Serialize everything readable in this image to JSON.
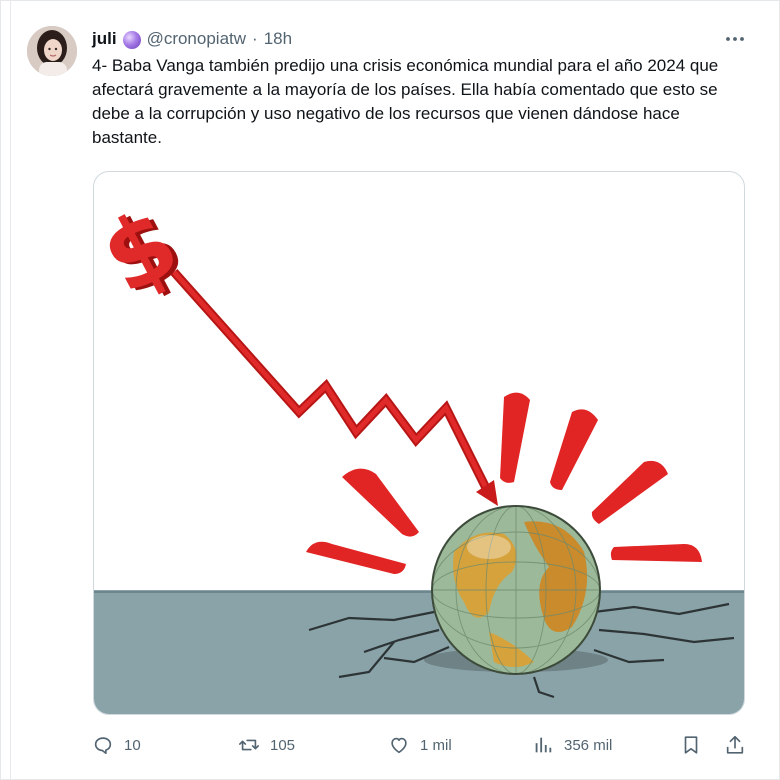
{
  "tweet": {
    "author": {
      "name": "juli",
      "emoji_icon": "crystal-ball-icon",
      "handle": "@cronopiatw",
      "separator": "·",
      "time": "18h"
    },
    "more_icon": "more-horizontal-icon",
    "text": "4- Baba Vanga también predijo una crisis económica mundial para el año 2024 que afectará gravemente a la mayoría de los países. Ella había comentado que esto se debe a la corrupción y uso negativo de los recursos que vienen dándose hace bastante.",
    "image": {
      "alt_semantics": "illustration: red dollar-sign arrow falling onto a cracking globe",
      "dollar_symbol": "$"
    },
    "actions": {
      "replies": {
        "icon": "reply-icon",
        "count": "10"
      },
      "retweets": {
        "icon": "retweet-icon",
        "count": "105"
      },
      "likes": {
        "icon": "heart-icon",
        "count": "1 mil"
      },
      "views": {
        "icon": "views-icon",
        "count": "356 mil"
      },
      "bookmark": {
        "icon": "bookmark-icon"
      },
      "share": {
        "icon": "share-icon"
      }
    }
  },
  "colors": {
    "text": "#0f1419",
    "muted": "#536471",
    "arrow_red": "#d81f1f",
    "ground": "#8aa3a8",
    "border": "#cfd9de"
  }
}
